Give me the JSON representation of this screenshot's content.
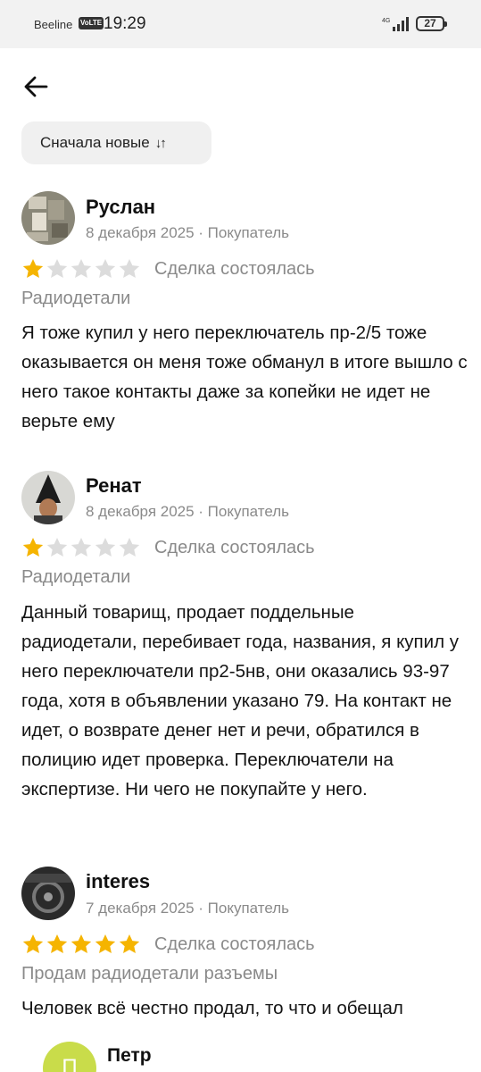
{
  "status_bar": {
    "carrier": "Beeline",
    "volte": "VoLTE",
    "time": "19:29",
    "network": "4G",
    "battery": "27"
  },
  "sort": {
    "label": "Сначала новые",
    "icon": "sort-arrows-icon"
  },
  "reviews": [
    {
      "name": "Руслан",
      "meta": "8 декабря 2025 · Покупатель",
      "rating": 1,
      "deal_status": "Сделка состоялась",
      "item": "Радиодетали",
      "text": "Я тоже купил у него переключатель пр-2/5 тоже оказывается он меня тоже обманул в итоге вышло с него такое контакты даже за копейки не идет не верьте ему"
    },
    {
      "name": "Ренат",
      "meta": "8 декабря 2025 · Покупатель",
      "rating": 1,
      "deal_status": "Сделка состоялась",
      "item": "Радиодетали",
      "text": "Данный товарищ, продает поддельные радиодетали, перебивает года, названия, я купил у него переключатели пр2-5нв, они оказались 93-97 года, хотя в объявлении указано 79. На контакт не идет, о возврате денег нет и речи, обратился в полицию идет проверка. Переключатели на экспертизе. Ни чего не покупайте у него."
    },
    {
      "name": "interes",
      "meta": "7 декабря 2025 · Покупатель",
      "rating": 5,
      "deal_status": "Сделка состоялась",
      "item": "Продам радиодетали разъемы",
      "text": "Человек всё честно продал, то что и обещал"
    }
  ],
  "reply": {
    "avatar_letter": "П",
    "name": "Петр"
  },
  "colors": {
    "star_filled": "#f5b400",
    "star_empty": "#dcdcdc",
    "reply_avatar": "#c9dc4a"
  }
}
